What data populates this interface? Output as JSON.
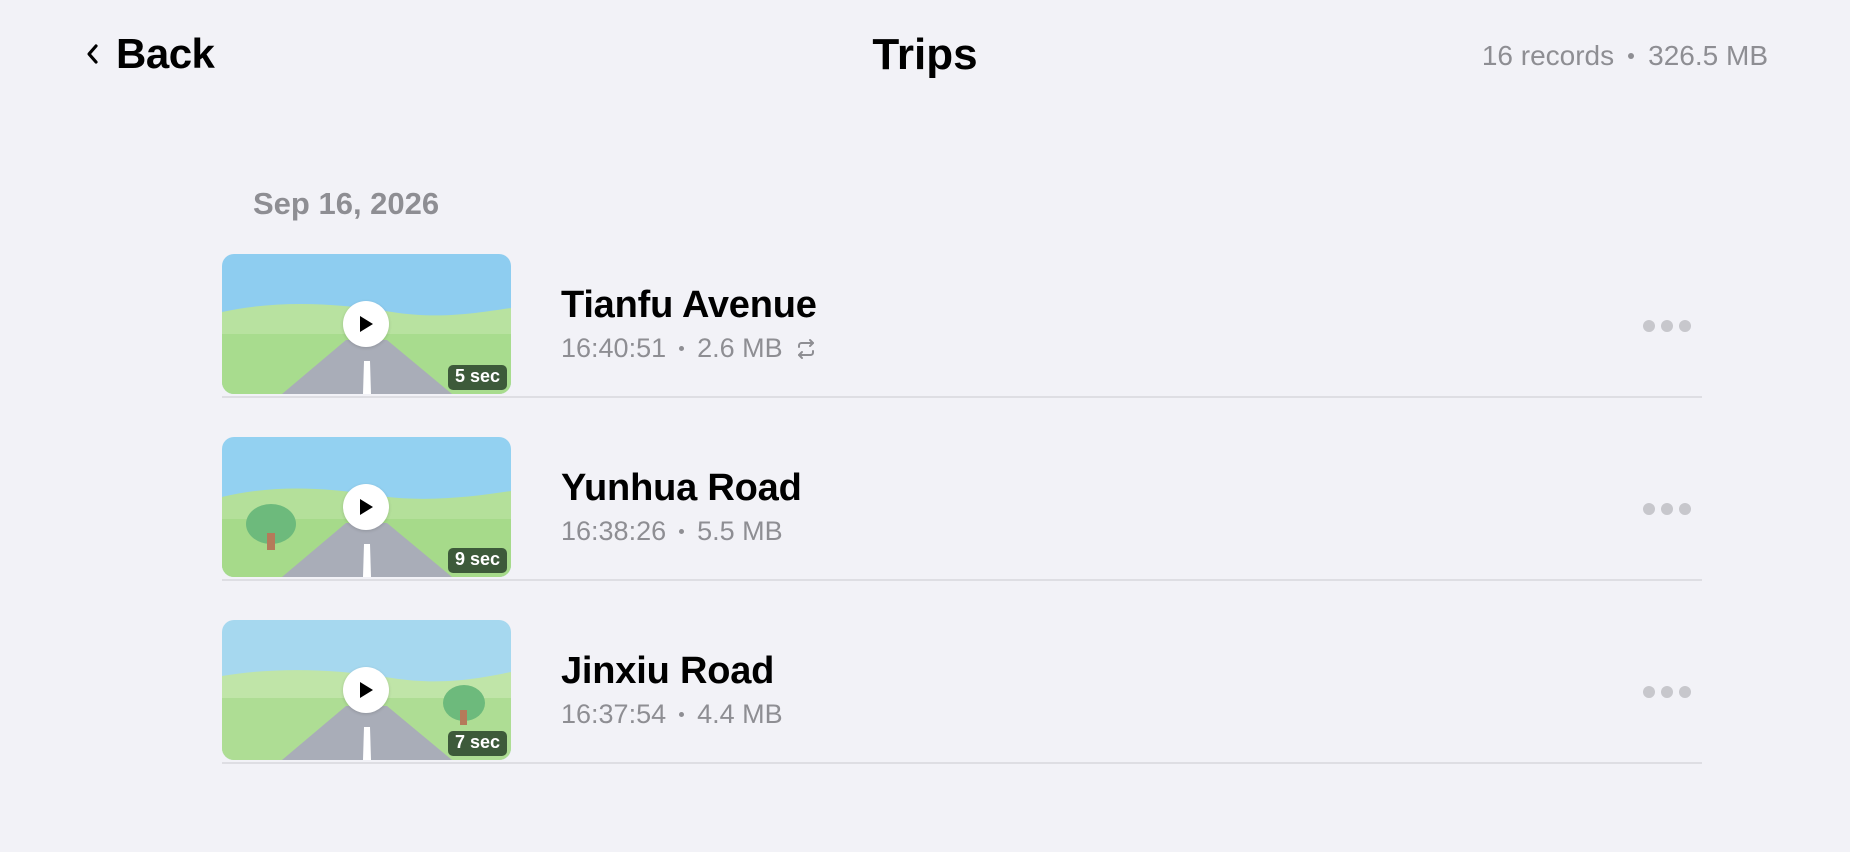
{
  "header": {
    "back_label": "Back",
    "title": "Trips",
    "record_count": "16 records",
    "total_size": "326.5 MB"
  },
  "groups": [
    {
      "date": "Sep 16, 2026",
      "items": [
        {
          "name": "Tianfu Avenue",
          "time": "16:40:51",
          "size": "2.6 MB",
          "duration": "5 sec",
          "synced_icon": "sync-icon",
          "thumbnail": "road-scene"
        },
        {
          "name": "Yunhua Road",
          "time": "16:38:26",
          "size": "5.5 MB",
          "duration": "9 sec",
          "thumbnail": "road-scene-tree-left"
        },
        {
          "name": "Jinxiu Road",
          "time": "16:37:54",
          "size": "4.4 MB",
          "duration": "7 sec",
          "thumbnail": "road-scene-tree-right"
        }
      ]
    }
  ],
  "colors": {
    "background": "#f2f2f7",
    "secondary_text": "#8e8e93",
    "sky": "#8ecdf0",
    "grass": "#a8dc8e",
    "road": "#a9adb8",
    "duration_badge": "#3d5a3a"
  }
}
